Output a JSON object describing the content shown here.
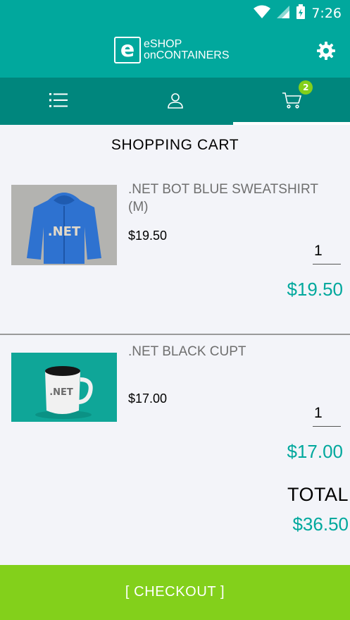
{
  "status_bar": {
    "time": "7:26",
    "icons": [
      "wifi-icon",
      "signal-icon",
      "battery-charging-icon"
    ]
  },
  "app_bar": {
    "logo_mark": "e",
    "logo_line1": "eSHOP",
    "logo_line2": "onCONTAINERS",
    "settings_icon": "gear-icon"
  },
  "tabs": [
    {
      "name": "catalog",
      "icon": "list-icon"
    },
    {
      "name": "profile",
      "icon": "user-icon"
    },
    {
      "name": "cart",
      "icon": "cart-icon",
      "badge": "2",
      "active": true
    }
  ],
  "page": {
    "title": "SHOPPING CART"
  },
  "cart": {
    "items": [
      {
        "name": ".NET BOT BLUE SWEATSHIRT (M)",
        "price": "$19.50",
        "quantity": "1",
        "total": "$19.50",
        "image_label": ".NET"
      },
      {
        "name": ".NET BLACK CUPT",
        "price": "$17.00",
        "quantity": "1",
        "total": "$17.00",
        "image_label": ".NET"
      }
    ],
    "total_label": "TOTAL",
    "total_value": "$36.50"
  },
  "checkout": {
    "label": "[ CHECKOUT ]"
  },
  "colors": {
    "primary": "#01a89d",
    "primary_dark": "#00867d",
    "accent_green": "#83d01b"
  }
}
